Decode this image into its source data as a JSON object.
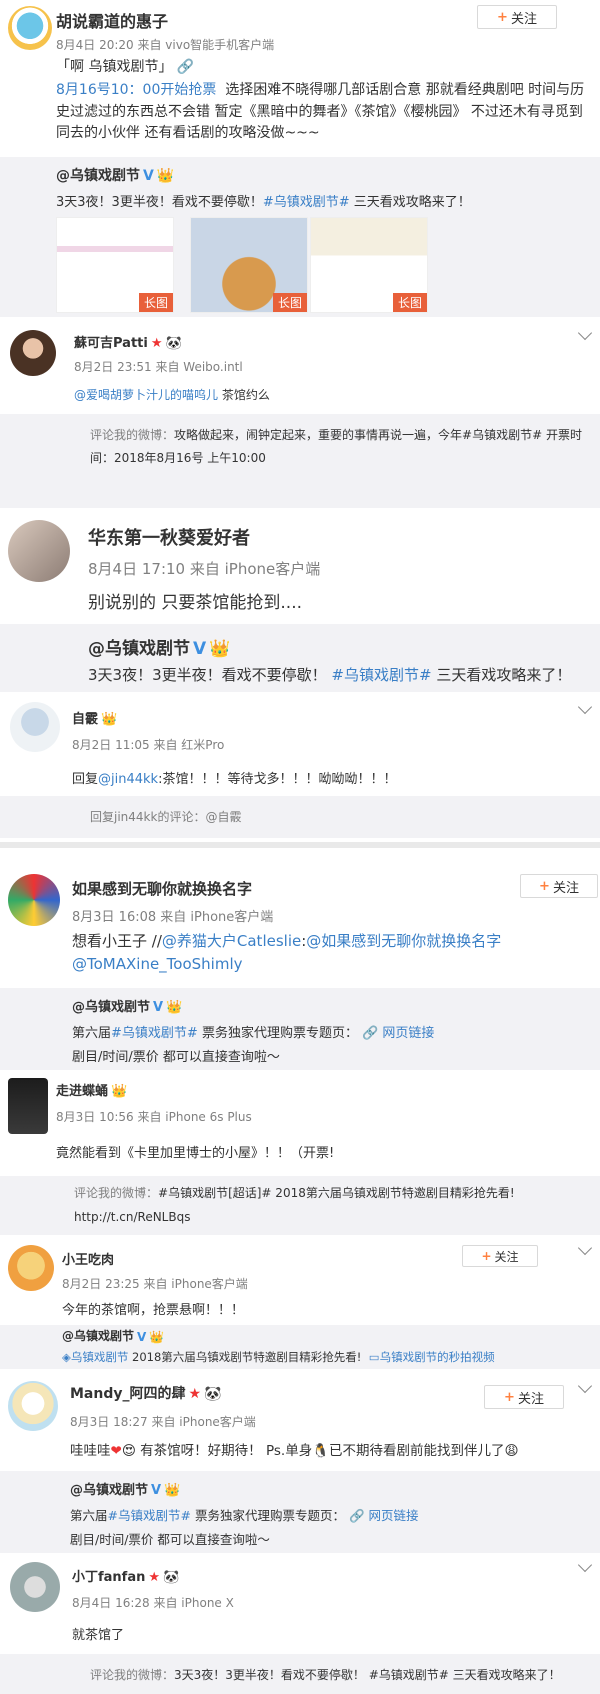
{
  "posts": [
    {
      "user": "胡说霸道的惠子",
      "meta": "8月4日 20:20 来自 vivo智能手机客户端",
      "follow": "关注",
      "topic_title": "「啊 乌镇戏剧节」",
      "text_time": "8月16号10：00开始抢票",
      "text": "选择困难不晓得哪几部话剧合意 那就看经典剧吧 时间与历史过滤过的东西总不会错 暂定《黑暗中的舞者》《茶馆》《樱桃园》 不过还木有寻觅到同去的小伙伴 还有看话剧的攻略没做~~~",
      "quote_user": "@乌镇戏剧节",
      "quote_text_pre": "3天3夜！3更半夜！看戏不要停歇！",
      "quote_tag": "#乌镇戏剧节#",
      "quote_text_post": "三天看戏攻略来了！",
      "thumb_label": "长图"
    },
    {
      "user": "蘇可吉Patti",
      "meta": "8月2日 23:51 来自 Weibo.intl",
      "mention": "@爱喝胡萝卜汁儿的喵呜儿",
      "text": "茶馆约么",
      "quote_prefix": "评论我的微博：",
      "quote_text": "攻略做起来，闹钟定起来，重要的事情再说一遍，今年#乌镇戏剧节# 开票时间：2018年8月16号 上午10:00"
    },
    {
      "user": "华东第一秋葵爱好者",
      "meta": "8月4日 17:10 来自 iPhone客户端",
      "text": "别说别的 只要茶馆能抢到....",
      "quote_user": "@乌镇戏剧节",
      "quote_text_pre": "3天3夜！3更半夜！看戏不要停歇！",
      "quote_tag": "#乌镇戏剧节#",
      "quote_text_post": "三天看戏攻略来了！"
    },
    {
      "user": "自霰",
      "meta": "8月2日 11:05 来自 红米Pro",
      "reply_prefix": "回复",
      "mention": "@jin44kk",
      "text": ":茶馆！！！等待戈多！！！呦呦呦！！！",
      "quote_text": "回复jin44kk的评论：@自霰"
    },
    {
      "user": "如果感到无聊你就换换名字",
      "meta": "8月3日 16:08 来自 iPhone客户端",
      "follow": "关注",
      "text_pre": "想看小王子 //",
      "mention1": "@养猫大户Catleslie",
      "mid": ":",
      "mention2": "@如果感到无聊你就换换名字",
      "mention3": "@ToMAXine_TooShimly",
      "quote_user": "@乌镇戏剧节",
      "quote_line1_pre": "第六届",
      "quote_tag": "#乌镇戏剧节#",
      "quote_line1_post": " 票务独家代理购票专题页：",
      "quote_link": "网页链接",
      "quote_line2": "剧目/时间/票价 都可以直接查询啦～"
    },
    {
      "user": "走进蝶蛹",
      "meta": "8月3日 10:56 来自 iPhone 6s Plus",
      "text": "竟然能看到《卡里加里博士的小屋》！！（开票!",
      "quote_prefix": "评论我的微博：",
      "quote_text": "#乌镇戏剧节[超话]# 2018第六届乌镇戏剧节特邀剧目精彩抢先看!",
      "quote_url": "http://t.cn/ReNLBqs"
    },
    {
      "user": "小王吃肉",
      "meta": "8月2日 23:25 来自 iPhone客户端",
      "follow": "关注",
      "text": "今年的茶馆啊，抢票悬啊！！！",
      "quote_user": "@乌镇戏剧节",
      "quote_link1": "乌镇戏剧节",
      "quote_text": " 2018第六届乌镇戏剧节特邀剧目精彩抢先看!",
      "quote_link2": "乌镇戏剧节的秒拍视频"
    },
    {
      "user": "Mandy_阿四的肆",
      "meta": "8月3日 18:27 来自 iPhone客户端",
      "follow": "关注",
      "text_pre": "哇哇哇",
      "text_mid": " 有茶馆呀！好期待！ Ps.单身",
      "text_post": "已不期待看剧前能找到伴儿了",
      "quote_user": "@乌镇戏剧节",
      "quote_line1_pre": "第六届",
      "quote_tag": "#乌镇戏剧节#",
      "quote_line1_post": " 票务独家代理购票专题页：",
      "quote_link": "网页链接",
      "quote_line2": "剧目/时间/票价 都可以直接查询啦～"
    },
    {
      "user": "小丁fanfan",
      "meta": "8月4日 16:28 来自 iPhone X",
      "text": "就茶馆了",
      "quote_prefix": "评论我的微博：",
      "quote_text": "3天3夜！3更半夜！看戏不要停歇！ #乌镇戏剧节# 三天看戏攻略来了！"
    }
  ],
  "colors": {
    "accent": "#eb7350",
    "link": "#3a7fc6",
    "quote_bg": "#f2f2f5",
    "long_tag": "#e8603a"
  }
}
